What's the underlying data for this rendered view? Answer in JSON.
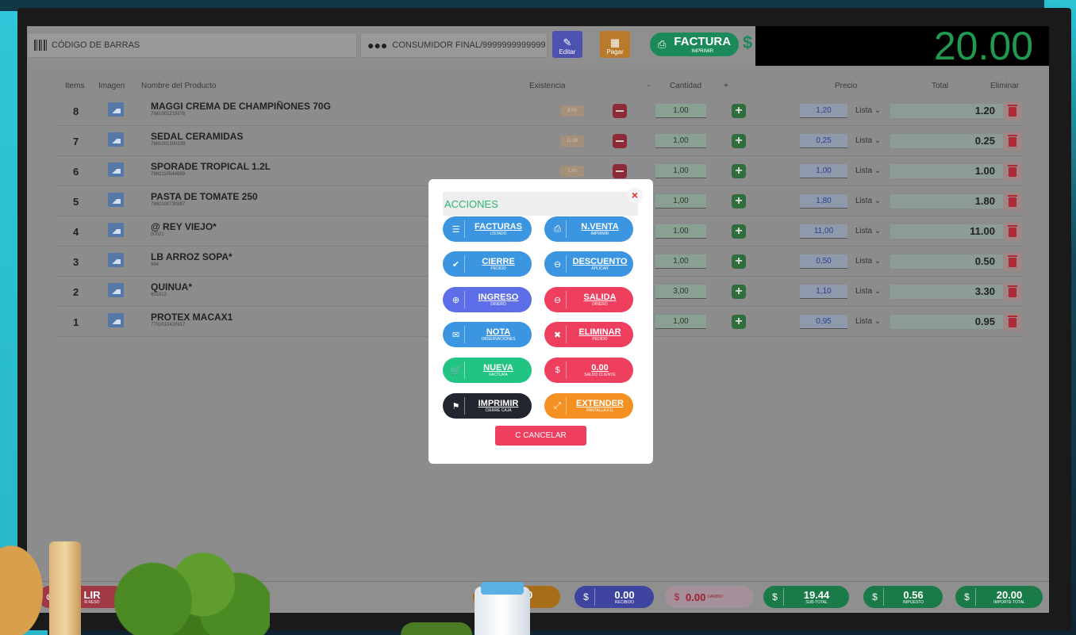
{
  "topbar": {
    "barcode_label": "CÓDIGO DE BARRAS",
    "customer": "CONSUMIDOR FINAL/9999999999999",
    "edit_label": "Editar",
    "pay_label": "Pagar",
    "factura_label": "FACTURA",
    "factura_sub": "IMPRIMIR",
    "currency": "$",
    "total": "20.00"
  },
  "table": {
    "headers": {
      "items": "Items",
      "image": "Imagen",
      "name": "Nombre del Producto",
      "stock": "Existencia",
      "minus": "-",
      "qty": "Cantidad",
      "plus": "+",
      "price": "Precio",
      "total": "Total",
      "delete": "Eliminar"
    },
    "rows": [
      {
        "num": "8",
        "name": "MAGGI CREMA DE CHAMPIÑONES 70G",
        "code": "7861001219876",
        "stock": "8.00",
        "qty": "1,00",
        "price": "1,20",
        "list": "Lista",
        "total": "1.20"
      },
      {
        "num": "7",
        "name": "SEDAL CERAMIDAS",
        "code": "7861001300239",
        "stock": "11.00",
        "qty": "1,00",
        "price": "0,25",
        "list": "Lista",
        "total": "0.25"
      },
      {
        "num": "6",
        "name": "SPORADE TROPICAL 1.2L",
        "code": "7862110544989",
        "stock": "1.00",
        "qty": "1,00",
        "price": "1,00",
        "list": "Lista",
        "total": "1.00"
      },
      {
        "num": "5",
        "name": "PASTA DE TOMATE 250",
        "code": "7862100730897",
        "stock": "",
        "qty": "1,00",
        "price": "1,80",
        "list": "Lista",
        "total": "1.80"
      },
      {
        "num": "4",
        "name": "@ REY VIEJO*",
        "code": "00021",
        "stock": "",
        "qty": "1,00",
        "price": "11,00",
        "list": "Lista",
        "total": "11.00"
      },
      {
        "num": "3",
        "name": "LB ARROZ SOPA*",
        "code": "684",
        "stock": "",
        "qty": "1,00",
        "price": "0,50",
        "list": "Lista",
        "total": "0.50"
      },
      {
        "num": "2",
        "name": "QUINUA*",
        "code": "651812",
        "stock": "",
        "qty": "3,00",
        "price": "1,10",
        "list": "Lista",
        "total": "3.30"
      },
      {
        "num": "1",
        "name": "PROTEX MACAX1",
        "code": "7702010420917",
        "stock": "",
        "qty": "1,00",
        "price": "0,95",
        "list": "Lista",
        "total": "0.95"
      }
    ]
  },
  "bottom": {
    "salir": "LIR",
    "salir_sub": "R RESO",
    "efectivo": "00",
    "efectivo_sub": "IVO",
    "recibido": "0.00",
    "recibido_sub": "RECIBIDO",
    "cambio": "0.00",
    "cambio_sub": "CAMBIO",
    "subtotal": "19.44",
    "subtotal_sub": "SUB-TOTAL",
    "impuesto": "0.56",
    "impuesto_sub": "IMPUESTO",
    "importe": "20.00",
    "importe_sub": "IMPORTE TOTAL",
    "currency": "$"
  },
  "modal": {
    "title": "ACCIONES",
    "close": "×",
    "cancel": "C CANCELAR",
    "actions": [
      {
        "label": "FACTURAS",
        "sub": "LISTADO"
      },
      {
        "label": "N.VENTA",
        "sub": "IMPRIMIR"
      },
      {
        "label": "CIERRE",
        "sub": "PEDIDO"
      },
      {
        "label": "DESCUENTO",
        "sub": "APLICAR"
      },
      {
        "label": "INGRESO",
        "sub": "DINERO"
      },
      {
        "label": "SALIDA",
        "sub": "DINERO"
      },
      {
        "label": "NOTA",
        "sub": "OBSERVACIONES"
      },
      {
        "label": "ELIMINAR",
        "sub": "PEDIDO"
      },
      {
        "label": "NUEVA",
        "sub": "FACTURA"
      },
      {
        "label": "0.00",
        "sub": "SALDO CLIENTE"
      },
      {
        "label": "IMPRIMIR",
        "sub": "CIERRE CAJA"
      },
      {
        "label": "EXTENDER",
        "sub": "PANTALLA F11"
      }
    ]
  },
  "icons": {
    "barcode": "barcode-icon",
    "users": "users-icon",
    "edit": "user-edit-icon",
    "pay": "cash-register-icon",
    "print": "print-icon",
    "image": "image-icon",
    "minus": "minus-square-icon",
    "plus": "plus-square-icon",
    "trash": "trash-icon",
    "close": "close-icon",
    "refresh": "refresh-icon"
  },
  "colors": {
    "accent_green": "#2bb673",
    "accent_red": "#ee3f5f",
    "accent_blue": "#3b95e0",
    "accent_orange": "#f59123",
    "display_green": "#1f9a50"
  }
}
